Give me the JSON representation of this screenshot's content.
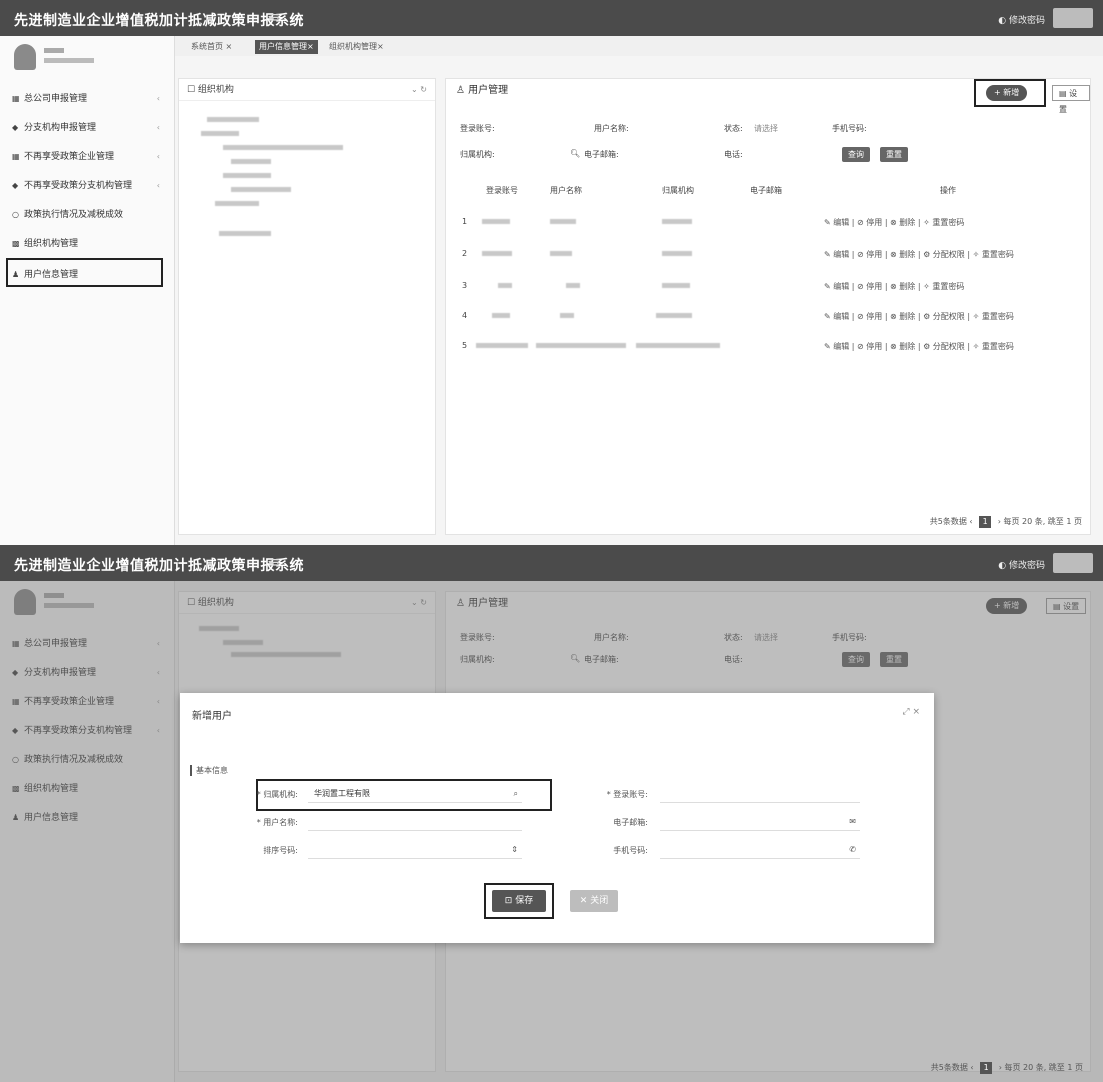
{
  "app": {
    "title": "先进制造业企业增值税加计抵减政策申报系统",
    "menu_icon": "hamburger-icon",
    "user_chip": "◐ 修改密码"
  },
  "sidebar": {
    "items": [
      {
        "label": "总公司申报管理",
        "icon": "grid-icon",
        "arrow": "‹"
      },
      {
        "label": "分支机构申报管理",
        "icon": "tag-icon",
        "arrow": "‹"
      },
      {
        "label": "不再享受政策企业管理",
        "icon": "grid-icon",
        "arrow": "‹"
      },
      {
        "label": "不再享受政策分支机构管理",
        "icon": "tag-icon",
        "arrow": "‹"
      },
      {
        "label": "政策执行情况及减税成效",
        "icon": "circle-icon",
        "arrow": ""
      },
      {
        "label": "组织机构管理",
        "icon": "org-icon",
        "arrow": ""
      },
      {
        "label": "用户信息管理",
        "icon": "user-icon",
        "arrow": ""
      }
    ]
  },
  "tabs": [
    {
      "label": "系统首页 ×"
    },
    {
      "label": "用户信息管理×"
    },
    {
      "label": "组织机构管理×"
    }
  ],
  "tree": {
    "title": "☐ 组织机构",
    "tools": "⌄ ↻"
  },
  "main": {
    "title": "♙ 用户管理",
    "add_label": "+ 新增",
    "download_label": "▤ 设置",
    "filters": {
      "login": "登录账号:",
      "username": "用户名称:",
      "status": "状态:",
      "status_value": "请选择",
      "phone": "手机号码:",
      "org": "归属机构:",
      "email": "电子邮箱:",
      "tel": "电话:",
      "search_icon": "search-icon",
      "query": "查询",
      "reset": "重置"
    },
    "columns": [
      "登录账号",
      "用户名称",
      "归属机构",
      "电子邮箱",
      "操作"
    ],
    "rows": [
      {
        "no": "1",
        "ops": "✎ 编辑 | ⊘ 停用 | ⊗ 删除 | ✧ 重置密码"
      },
      {
        "no": "2",
        "ops": "✎ 编辑 | ⊘ 停用 | ⊗ 删除 | ⚙ 分配权限 | ✧ 重置密码"
      },
      {
        "no": "3",
        "ops": "✎ 编辑 | ⊘ 停用 | ⊗ 删除 | ✧ 重置密码"
      },
      {
        "no": "4",
        "ops": "✎ 编辑 | ⊘ 停用 | ⊗ 删除 | ⚙ 分配权限 | ✧ 重置密码"
      },
      {
        "no": "5",
        "ops": "✎ 编辑 | ⊘ 停用 | ⊗ 删除 | ⚙ 分配权限 | ✧ 重置密码"
      }
    ],
    "pager": {
      "total": "共5条数据",
      "prev": "‹",
      "page": "1",
      "next": "›",
      "size": "每页 20 条, 跳至",
      "tail": "1 页"
    }
  },
  "modal": {
    "title": "新增用户",
    "controls": "⤢  ×",
    "section": "基本信息",
    "fields": {
      "org_label": "* 归属机构:",
      "org_value": "华润置工程有限",
      "login_label": "* 登录账号:",
      "user_label": "* 用户名称:",
      "email_label": "电子邮箱:",
      "sort_label": "排序号码:",
      "sort_value": "",
      "phone_label": "手机号码:"
    },
    "save_label": "⊡ 保存",
    "close_label": "✕ 关闭"
  }
}
